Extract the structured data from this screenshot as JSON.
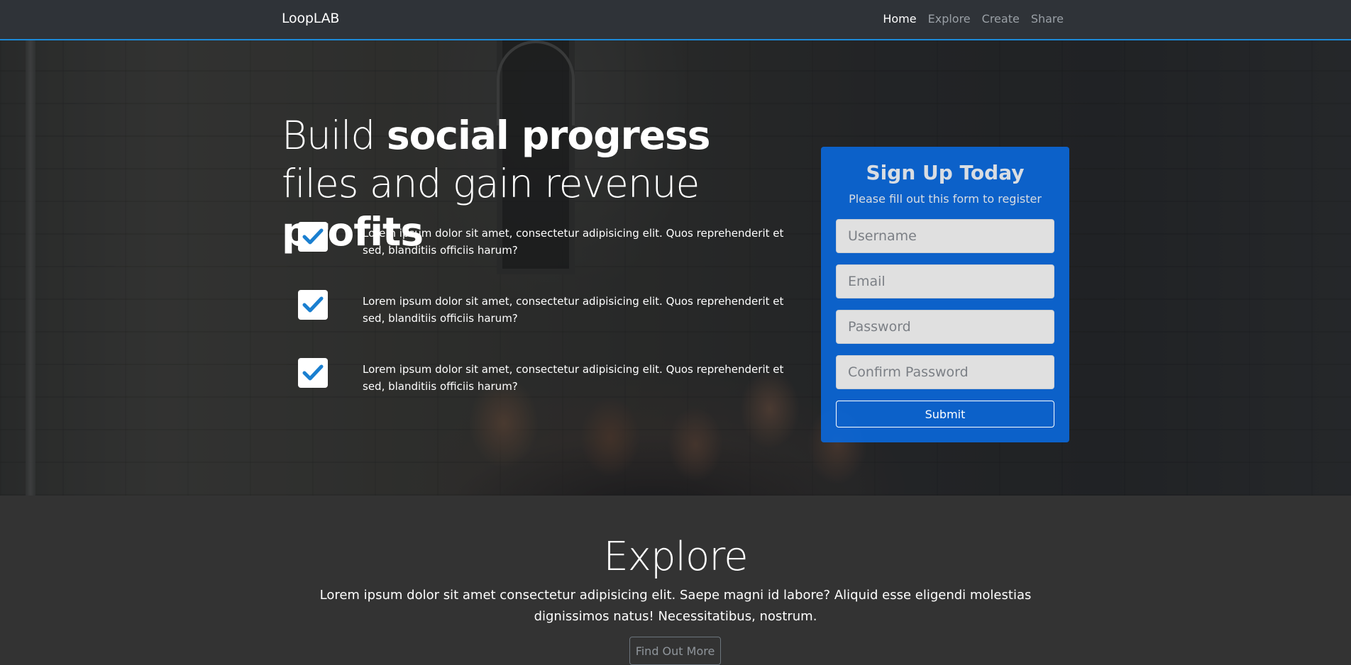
{
  "navbar": {
    "brand": "LoopLAB",
    "links": [
      {
        "label": "Home",
        "active": true
      },
      {
        "label": "Explore",
        "active": false
      },
      {
        "label": "Create",
        "active": false
      },
      {
        "label": "Share",
        "active": false
      }
    ],
    "accent_color": "#1c8ad8"
  },
  "hero": {
    "headline": {
      "part1": "Build ",
      "bold1": "social progress",
      "part2": " files and gain revenue ",
      "bold2": "profits"
    },
    "features": [
      {
        "icon": "check-icon",
        "text": "Lorem ipsum dolor sit amet, consectetur adipisicing elit. Quos reprehenderit et sed, blanditiis officiis harum?"
      },
      {
        "icon": "check-icon",
        "text": "Lorem ipsum dolor sit amet, consectetur adipisicing elit. Quos reprehenderit et sed, blanditiis officiis harum?"
      },
      {
        "icon": "check-icon",
        "text": "Lorem ipsum dolor sit amet, consectetur adipisicing elit. Quos reprehenderit et sed, blanditiis officiis harum?"
      }
    ],
    "check_color": "#1a7fd0"
  },
  "signup": {
    "title": "Sign Up Today",
    "subtitle": "Please fill out this form to register",
    "fields": {
      "username": {
        "placeholder": "Username",
        "value": ""
      },
      "email": {
        "placeholder": "Email",
        "value": ""
      },
      "password": {
        "placeholder": "Password",
        "value": ""
      },
      "confirm_password": {
        "placeholder": "Confirm Password",
        "value": ""
      }
    },
    "submit_label": "Submit",
    "card_color": "#0a68dc"
  },
  "explore": {
    "title": "Explore",
    "text": "Lorem ipsum dolor sit amet consectetur adipisicing elit. Saepe magni id labore? Aliquid esse eligendi molestias dignissimos natus! Necessitatibus, nostrum.",
    "button_label": "Find Out More"
  }
}
